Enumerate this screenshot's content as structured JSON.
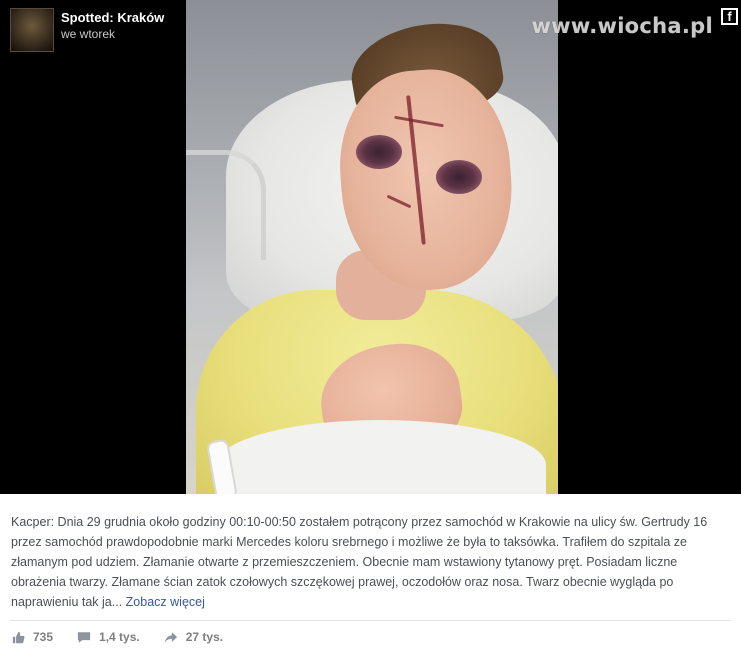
{
  "page": {
    "name": "Spotted: Kraków",
    "time": "we wtorek"
  },
  "watermark": {
    "text": "www.wiocha.pl",
    "badge": "f"
  },
  "post": {
    "text": "Kacper: Dnia 29 grudnia około godziny 00:10-00:50 zostałem potrącony przez samochód w Krakowie na ulicy św. Gertrudy 16 przez samochód prawdopodobnie marki Mercedes koloru srebrnego i możliwe że była to taksówka. Trafiłem do szpitala ze złamanym pod udziem. Złamanie otwarte z przemieszczeniem. Obecnie mam wstawiony tytanowy pręt. Posiadam liczne obrażenia twarzy. Złamane ścian zatok czołowych szczękowej prawej, oczodołów oraz nosa. Twarz obecnie wygląda po naprawieniu tak ja...",
    "see_more": "Zobacz więcej"
  },
  "stats": {
    "likes": "735",
    "comments": "1,4 tys.",
    "shares": "27 tys."
  },
  "icons": {
    "like": "thumbs-up-icon",
    "comment": "speech-bubble-icon",
    "share": "share-arrow-icon",
    "badge": "facebook-icon"
  },
  "colors": {
    "link": "#385898",
    "text": "#4b4f56",
    "muted": "#7f7f7f",
    "media_background": "#000000"
  }
}
